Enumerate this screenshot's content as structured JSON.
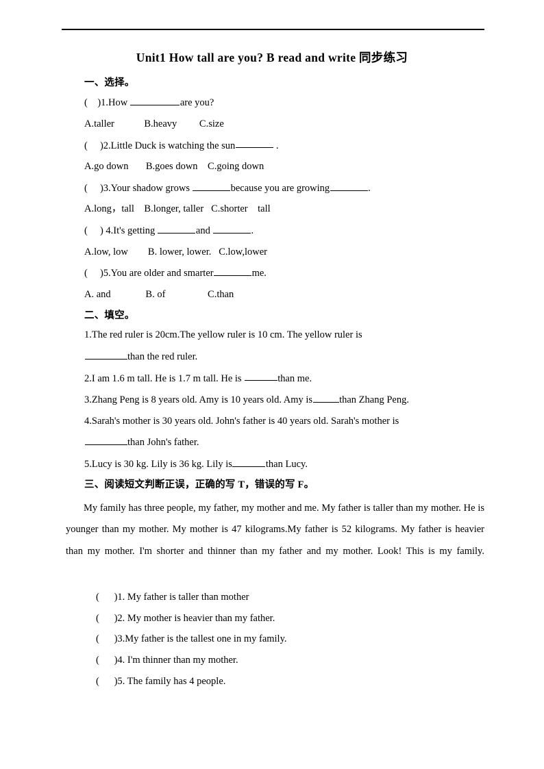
{
  "document": {
    "title": "Unit1 How tall are you? B read and write 同步练习"
  },
  "sections": {
    "one": {
      "heading": "一、选择。",
      "questions": [
        {
          "stem_prefix": "(    )1.How ",
          "stem_suffix": "are you?",
          "blank": "b-xl",
          "options": "A.taller            B.heavy         C.size"
        },
        {
          "stem_prefix": "(     )2.Little Duck is watching the sun",
          "stem_suffix": " .",
          "blank": "b-md",
          "options": "A.go down       B.goes down    C.going down"
        },
        {
          "stem_prefix": "(     )3.Your shadow grows ",
          "stem_mid": "because you are growing",
          "stem_suffix": ".",
          "blank": "b-md",
          "blank2": "b-md",
          "options": "A.long，tall    B.longer, taller   C.shorter    tall"
        },
        {
          "stem_prefix": "(     ) 4.It's getting ",
          "stem_mid": "and ",
          "stem_suffix": ".",
          "blank": "b-md",
          "blank2": "b-md",
          "options": "A.low, low        B. lower, lower.   C.low,lower"
        },
        {
          "stem_prefix": "(     )5.You are older and smarter",
          "stem_suffix": "me.",
          "blank": "b-md",
          "options": "A. and              B. of                 C.than"
        }
      ]
    },
    "two": {
      "heading": "二、填空。",
      "items": [
        {
          "line1": "1.The red ruler is 20cm.The yellow ruler is 10 cm. The yellow ruler is",
          "line2_blank": "b-lg",
          "line2_text": "than the red ruler."
        },
        {
          "prefix": "2.I am 1.6 m tall. He is 1.7 m tall. He is ",
          "blank": "b-sm",
          "suffix": "than me."
        },
        {
          "prefix": "3.Zhang Peng is 8 years old. Amy is 10 years old. Amy is",
          "blank": "b-xs",
          "suffix": "than Zhang Peng."
        },
        {
          "line1": "4.Sarah's mother is 30 years old. John's father is 40 years old. Sarah's mother is",
          "line2_blank": "b-lg",
          "line2_text": "than John's father."
        },
        {
          "prefix": "5.Lucy is 30 kg. Lily is 36 kg. Lily is",
          "blank": "b-sm",
          "suffix": "than Lucy."
        }
      ]
    },
    "three": {
      "heading": "三、阅读短文判断正误，正确的写 T，错误的写 F。",
      "passage": "My family has three people, my father, my mother and me. My father is taller than my mother. He is younger than my mother. My mother is 47 kilograms.My father is 52 kilograms. My father is heavier than my mother. I'm shorter and thinner than my father and my mother. Look! This is my family.",
      "statements": [
        "(      )1. My father is taller than mother",
        "(      )2. My mother is heavier than my father.",
        "(      )3.My father is the tallest one in my family.",
        "(      )4. I'm thinner than my mother.",
        "(      )5. The family has 4 people."
      ]
    }
  }
}
